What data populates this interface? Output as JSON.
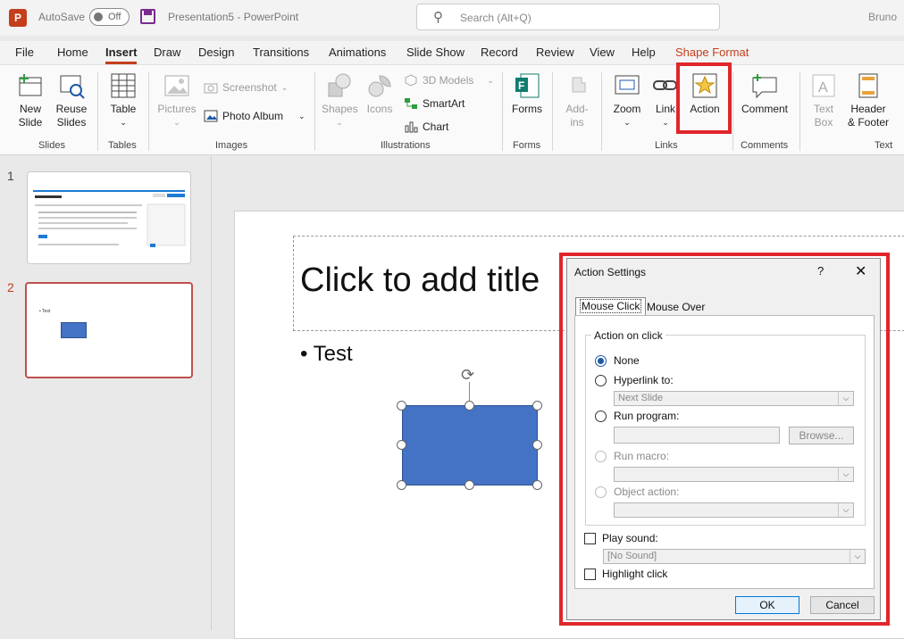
{
  "titlebar": {
    "app_logo": "P",
    "autosave_label": "AutoSave",
    "autosave_state": "Off",
    "doc_title": "Presentation5  -  PowerPoint",
    "search_placeholder": "Search (Alt+Q)",
    "user": "Bruno"
  },
  "menu": {
    "tabs": [
      "File",
      "Home",
      "Insert",
      "Draw",
      "Design",
      "Transitions",
      "Animations",
      "Slide Show",
      "Record",
      "Review",
      "View",
      "Help",
      "Shape Format"
    ],
    "active": "Insert"
  },
  "ribbon": {
    "slides": {
      "new_slide": "New\nSlide",
      "reuse_slides": "Reuse\nSlides",
      "label": "Slides"
    },
    "tables": {
      "table": "Table",
      "label": "Tables"
    },
    "images": {
      "pictures": "Pictures",
      "screenshot": "Screenshot",
      "photo_album": "Photo Album",
      "label": "Images"
    },
    "illustrations": {
      "shapes": "Shapes",
      "icons": "Icons",
      "models": "3D Models",
      "smartart": "SmartArt",
      "chart": "Chart",
      "label": "Illustrations"
    },
    "forms": {
      "forms": "Forms",
      "label": "Forms"
    },
    "addins": {
      "addins": "Add-\nins"
    },
    "links": {
      "zoom": "Zoom",
      "link": "Link",
      "action": "Action",
      "label": "Links"
    },
    "comments": {
      "comment": "Comment",
      "label": "Comments"
    },
    "text": {
      "textbox": "Text\nBox",
      "header_footer": "Header\n& Footer",
      "label": "Text"
    }
  },
  "thumbnails": [
    {
      "number": "1"
    },
    {
      "number": "2",
      "bullet": "• Test"
    }
  ],
  "slide": {
    "title_placeholder": "Click to add title",
    "bullet": "• Test"
  },
  "dialog": {
    "title": "Action Settings",
    "help": "?",
    "close": "✕",
    "tabs": [
      "Mouse Click",
      "Mouse Over"
    ],
    "group_label": "Action on click",
    "options": {
      "none": "None",
      "hyperlink": "Hyperlink to:",
      "hyperlink_value": "Next Slide",
      "run_program": "Run program:",
      "browse": "Browse...",
      "run_macro": "Run macro:",
      "object_action": "Object action:"
    },
    "play_sound": "Play sound:",
    "sound_value": "[No Sound]",
    "highlight_click": "Highlight click",
    "ok": "OK",
    "cancel": "Cancel"
  },
  "colors": {
    "accent": "#c43e1c",
    "highlight": "#e0262b",
    "shape_fill": "#4472c4"
  }
}
